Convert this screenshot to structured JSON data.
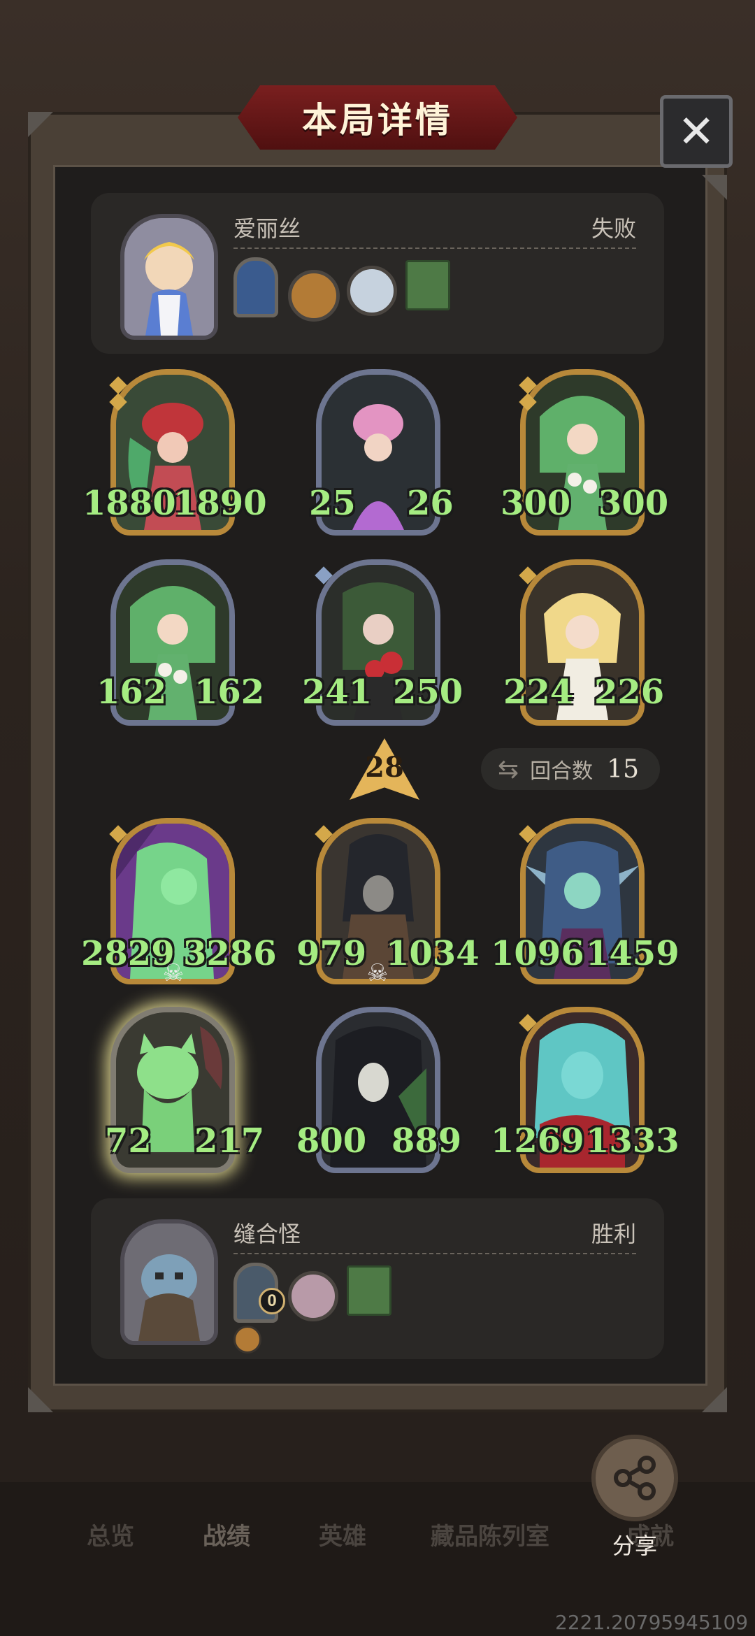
{
  "title": "本局详情",
  "close_label": "✕",
  "player_top": {
    "name": "爱丽丝",
    "result": "失败"
  },
  "player_bottom": {
    "name": "缝合怪",
    "result": "胜利",
    "relic_badge": "0"
  },
  "round": {
    "label": "回合数",
    "value": "15"
  },
  "center_marker": "28",
  "top_board": [
    {
      "atk": "1880",
      "hp": "1890"
    },
    {
      "atk": "25",
      "hp": "26"
    },
    {
      "atk": "300",
      "hp": "300"
    },
    {
      "atk": "162",
      "hp": "162"
    },
    {
      "atk": "241",
      "hp": "250"
    },
    {
      "atk": "224",
      "hp": "226"
    }
  ],
  "bottom_board": [
    {
      "atk": "2829",
      "hp": "3286"
    },
    {
      "atk": "979",
      "hp": "1034"
    },
    {
      "atk": "1096",
      "hp": "1459"
    },
    {
      "atk": "72",
      "hp": "217"
    },
    {
      "atk": "800",
      "hp": "889"
    },
    {
      "atk": "1269",
      "hp": "1333"
    }
  ],
  "nav": [
    "总览",
    "战绩",
    "英雄",
    "藏品陈列室",
    "成就"
  ],
  "share_label": "分享",
  "coordinates": "2221.20795945109",
  "colors": {
    "stat_green": "#a5ec82",
    "gold_frame": "#b8893a",
    "title_red": "#7a1f1f"
  }
}
